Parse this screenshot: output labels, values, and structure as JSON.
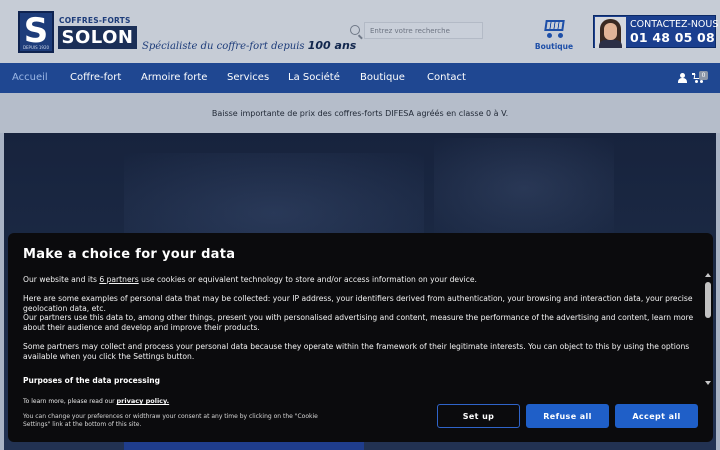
{
  "header": {
    "logo_letter": "S",
    "logo_since": "DEPUIS 1920",
    "logo_top": "COFFRES-FORTS",
    "logo_name": "SOLON",
    "tagline_prefix": "Spécialiste du coffre-fort depuis ",
    "tagline_bold": "100 ans",
    "search_placeholder": "Entrez votre recherche",
    "boutique_label": "Boutique",
    "contact_title": "CONTACTEZ-NOUS",
    "contact_phone": "01 48 05 08 34"
  },
  "nav": {
    "items": [
      {
        "label": "Accueil",
        "active": true
      },
      {
        "label": "Coffre-fort",
        "active": false
      },
      {
        "label": "Armoire forte",
        "active": false
      },
      {
        "label": "Services",
        "active": false
      },
      {
        "label": "La Société",
        "active": false
      },
      {
        "label": "Boutique",
        "active": false
      },
      {
        "label": "Contact",
        "active": false
      }
    ],
    "cart_count": "0"
  },
  "announcement": "Baisse importante de prix des coffres-forts DIFESA agréés en classe 0 à V.",
  "consent": {
    "title": "Make a choice for your data",
    "p1_before": "Our website and its ",
    "p1_link": "6 partners",
    "p1_after": " use cookies or equivalent technology to store and/or access information on your device.",
    "p2": "Here are some examples of personal data that may be collected: your IP address, your identifiers derived from authentication, your browsing and interaction data, your precise geolocation data, etc.",
    "p3": "Our partners use this data to, among other things, present you with personalised advertising and content, measure the performance of the advertising and content, learn more about their audience and develop and improve their products.",
    "p4": "Some partners may collect and process your personal data because they operate within the framework of their legitimate interests. You can object to this by using the options available when you click the Settings button.",
    "purposes_heading": "Purposes of the data processing",
    "learn_prefix": "To learn more, please read our ",
    "learn_link": "privacy policy.",
    "change_text": "You can change your preferences or widthraw your consent at any time by clicking on the \"Cookie Settings\" link at the bottom of this site.",
    "setup_label": "Set up",
    "refuse_label": "Refuse all",
    "accept_label": "Accept all"
  },
  "colors": {
    "nav_bg": "#1f4791",
    "brand_blue": "#1d3c7a",
    "button_blue": "#1f5fc8",
    "modal_bg": "#0b0b0d"
  }
}
